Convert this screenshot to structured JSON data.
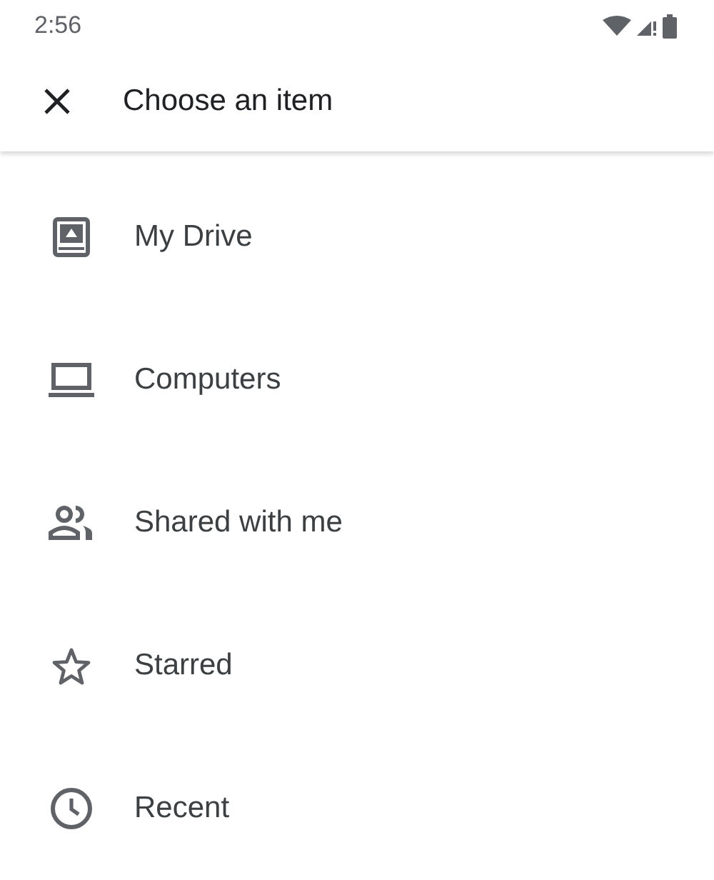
{
  "status_bar": {
    "time": "2:56"
  },
  "toolbar": {
    "title": "Choose an item"
  },
  "items": [
    {
      "kind": "drive",
      "label": "My Drive"
    },
    {
      "kind": "computer",
      "label": "Computers"
    },
    {
      "kind": "shared",
      "label": "Shared with me"
    },
    {
      "kind": "starred",
      "label": "Starred"
    },
    {
      "kind": "recent",
      "label": "Recent"
    }
  ]
}
